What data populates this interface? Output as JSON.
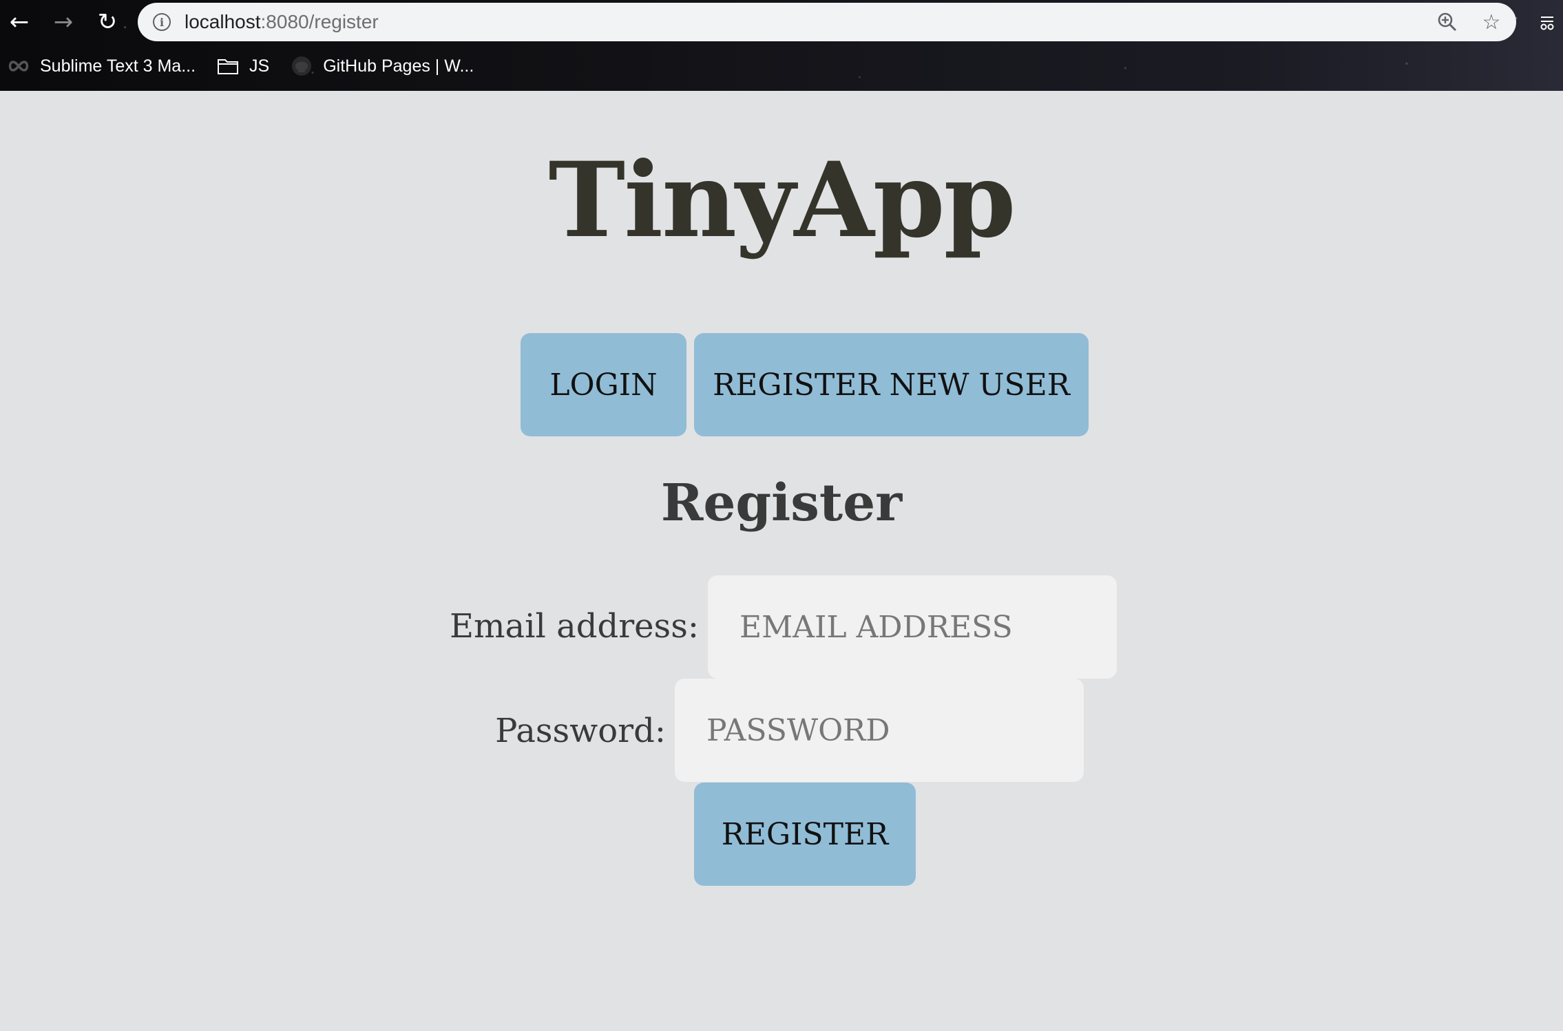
{
  "browser": {
    "url_host": "localhost",
    "url_path": ":8080/register",
    "nav": {
      "back": "←",
      "forward": "→",
      "reload": "↻"
    },
    "omnibox_icons": {
      "info": "i",
      "zoom": "zoom-icon",
      "star": "☆"
    },
    "bookmarks": [
      {
        "label": "Sublime Text 3 Ma...",
        "icon": "infinity-icon"
      },
      {
        "label": "JS",
        "icon": "folder-icon"
      },
      {
        "label": "GitHub Pages | W...",
        "icon": "github-icon"
      }
    ]
  },
  "page": {
    "app_title": "TinyApp",
    "nav_buttons": {
      "login": "LOGIN",
      "register_new_user": "REGISTER NEW USER"
    },
    "form": {
      "title": "Register",
      "email_label": "Email address:",
      "email_placeholder": "EMAIL ADDRESS",
      "email_value": "",
      "password_label": "Password:",
      "password_placeholder": "PASSWORD",
      "password_value": "",
      "submit_label": "REGISTER"
    }
  },
  "colors": {
    "page_background": "#e1e2e4",
    "button_background": "#90bcd6",
    "input_background": "#f1f1f1",
    "title_color": "#34342b"
  }
}
